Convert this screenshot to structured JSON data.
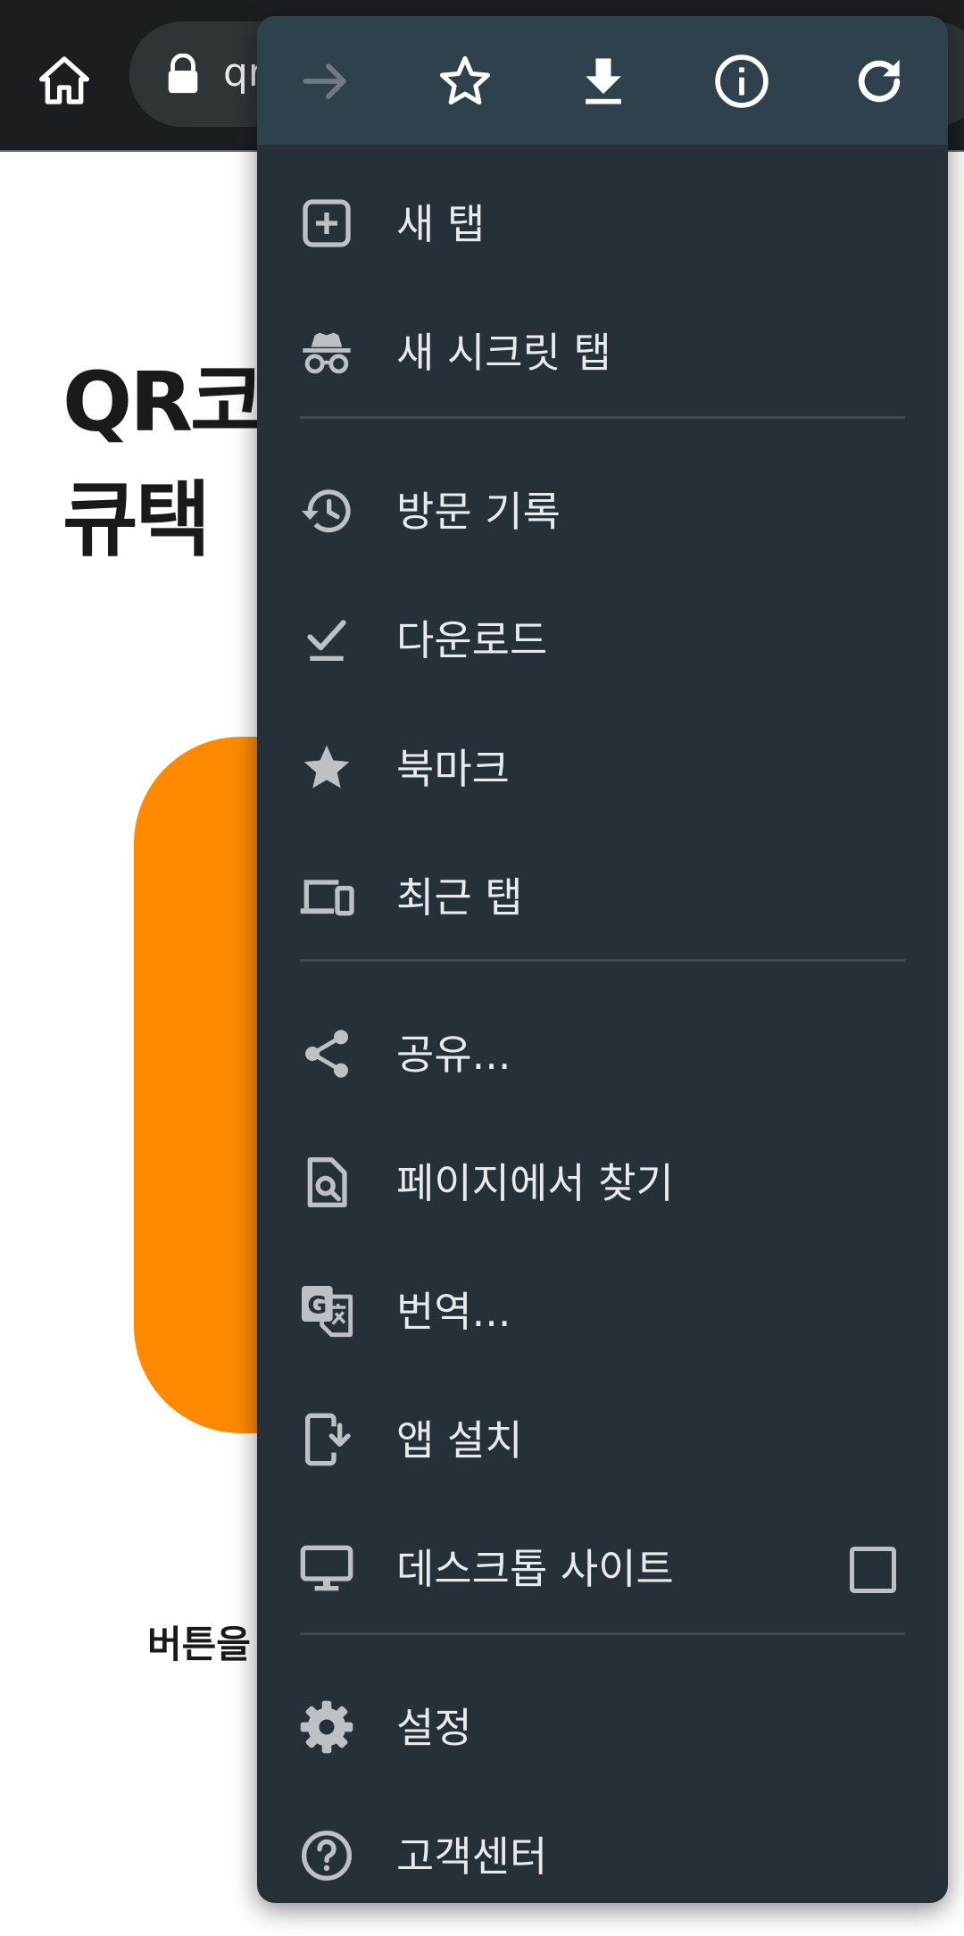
{
  "browser": {
    "url": "qr"
  },
  "page": {
    "title_lines": [
      "QR코",
      "큐택"
    ],
    "body_text": "버튼을"
  },
  "menu": {
    "items": [
      {
        "label": "새 탭",
        "icon": "new-tab-icon"
      },
      {
        "label": "새 시크릿 탭",
        "icon": "incognito-icon"
      },
      {
        "label": "방문 기록",
        "icon": "history-icon"
      },
      {
        "label": "다운로드",
        "icon": "downloads-icon"
      },
      {
        "label": "북마크",
        "icon": "bookmarks-icon"
      },
      {
        "label": "최근 탭",
        "icon": "recent-tabs-icon"
      },
      {
        "label": "공유...",
        "icon": "share-icon"
      },
      {
        "label": "페이지에서 찾기",
        "icon": "find-in-page-icon"
      },
      {
        "label": "번역...",
        "icon": "translate-icon"
      },
      {
        "label": "앱 설치",
        "icon": "install-app-icon"
      },
      {
        "label": "데스크톱 사이트",
        "icon": "desktop-icon",
        "checked": false
      },
      {
        "label": "설정",
        "icon": "settings-icon"
      },
      {
        "label": "고객센터",
        "icon": "help-icon"
      }
    ],
    "toolbar": [
      "forward-icon",
      "star-icon",
      "download-icon",
      "info-icon",
      "refresh-icon"
    ]
  },
  "colors": {
    "menu_bg": "#263038",
    "menu_toolbar_bg": "#2f414c",
    "menu_text": "#e8eaed",
    "icon": "#bdc1c6",
    "accent_card": "#ff8a00",
    "topbar_bg": "#1b1e21"
  }
}
